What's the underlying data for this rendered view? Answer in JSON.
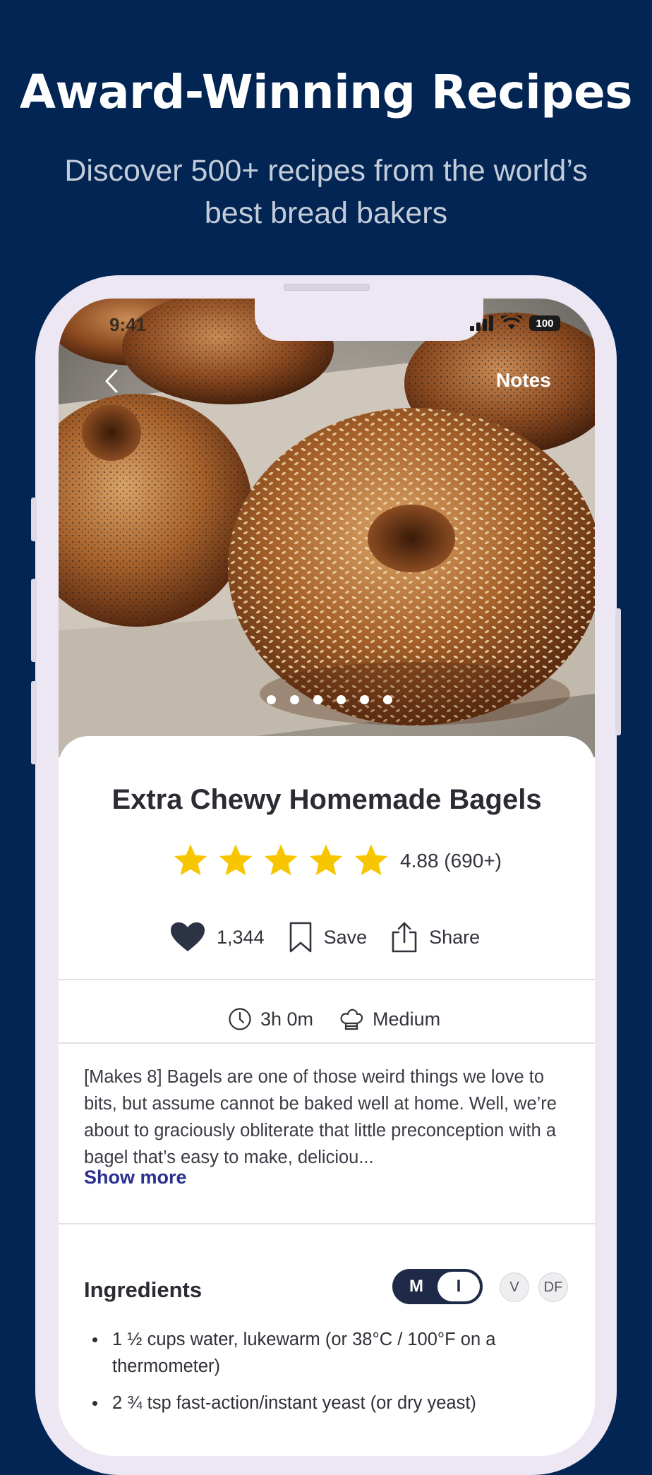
{
  "promo": {
    "headline": "Award-Winning Recipes",
    "subheadline": "Discover 500+ recipes from the world’s best bread bakers"
  },
  "status_bar": {
    "time": "9:41",
    "battery": "100"
  },
  "hero": {
    "notes_label": "Notes",
    "image_count": 6,
    "active_index": 0
  },
  "recipe": {
    "title": "Extra Chewy Homemade Bagels",
    "rating_stars": 5,
    "rating_text": "4.88 (690+)",
    "likes": "1,344",
    "save_label": "Save",
    "share_label": "Share",
    "time": "3h 0m",
    "difficulty": "Medium",
    "description": "[Makes 8] Bagels are one of those weird things we love to bits, but assume cannot be baked well at home. Well, we’re about to graciously obliterate that little preconception with a bagel that’s easy to make, deliciou...",
    "show_more": "Show more"
  },
  "ingredients": {
    "title": "Ingredients",
    "unit_metric": "M",
    "unit_imperial": "I",
    "diet_vegan": "V",
    "diet_dairy_free": "DF",
    "items": [
      "1 ½ cups water, lukewarm (or 38°C / 100°F on a thermometer)",
      "2 ¾ tsp fast-action/instant yeast (or dry yeast)"
    ]
  },
  "colors": {
    "background": "#022553",
    "accent_link": "#2b2f8f",
    "star": "#f7c600",
    "toggle": "#1e2a48"
  }
}
